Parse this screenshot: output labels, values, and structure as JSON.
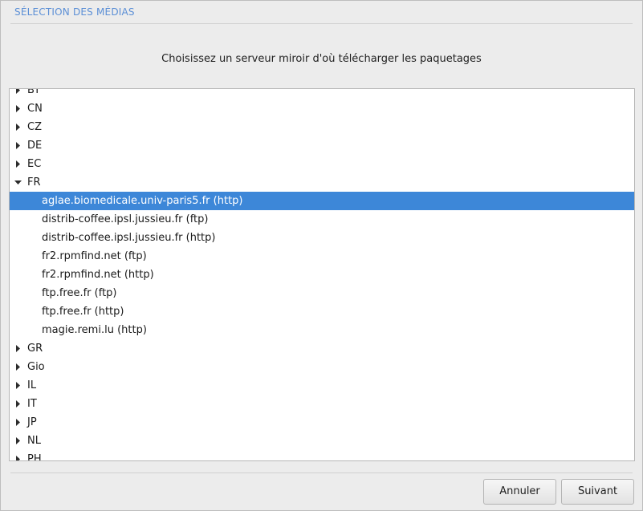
{
  "header": {
    "title": "SÉLECTION DES MÉDIAS"
  },
  "prompt": "Choisissez un serveur miroir d'où télécharger les paquetages",
  "tree": {
    "rows": [
      {
        "type": "parent",
        "label": "BY",
        "expanded": false,
        "selected": false
      },
      {
        "type": "parent",
        "label": "CN",
        "expanded": false,
        "selected": false
      },
      {
        "type": "parent",
        "label": "CZ",
        "expanded": false,
        "selected": false
      },
      {
        "type": "parent",
        "label": "DE",
        "expanded": false,
        "selected": false
      },
      {
        "type": "parent",
        "label": "EC",
        "expanded": false,
        "selected": false
      },
      {
        "type": "parent",
        "label": "FR",
        "expanded": true,
        "selected": false
      },
      {
        "type": "child",
        "label": "aglae.biomedicale.univ-paris5.fr (http)",
        "selected": true
      },
      {
        "type": "child",
        "label": "distrib-coffee.ipsl.jussieu.fr (ftp)",
        "selected": false
      },
      {
        "type": "child",
        "label": "distrib-coffee.ipsl.jussieu.fr (http)",
        "selected": false
      },
      {
        "type": "child",
        "label": "fr2.rpmfind.net (ftp)",
        "selected": false
      },
      {
        "type": "child",
        "label": "fr2.rpmfind.net (http)",
        "selected": false
      },
      {
        "type": "child",
        "label": "ftp.free.fr (ftp)",
        "selected": false
      },
      {
        "type": "child",
        "label": "ftp.free.fr (http)",
        "selected": false
      },
      {
        "type": "child",
        "label": "magie.remi.lu (http)",
        "selected": false
      },
      {
        "type": "parent",
        "label": "GR",
        "expanded": false,
        "selected": false
      },
      {
        "type": "parent",
        "label": "Gio",
        "expanded": false,
        "selected": false
      },
      {
        "type": "parent",
        "label": "IL",
        "expanded": false,
        "selected": false
      },
      {
        "type": "parent",
        "label": "IT",
        "expanded": false,
        "selected": false
      },
      {
        "type": "parent",
        "label": "JP",
        "expanded": false,
        "selected": false
      },
      {
        "type": "parent",
        "label": "NL",
        "expanded": false,
        "selected": false
      },
      {
        "type": "parent",
        "label": "PH",
        "expanded": false,
        "selected": false
      }
    ]
  },
  "buttons": {
    "cancel_label": "Annuler",
    "next_label": "Suivant"
  },
  "colors": {
    "accent": "#3d87d8",
    "header": "#5b8fd6"
  },
  "icons": {
    "collapsed": "triangle-right-icon",
    "expanded": "triangle-down-icon"
  }
}
